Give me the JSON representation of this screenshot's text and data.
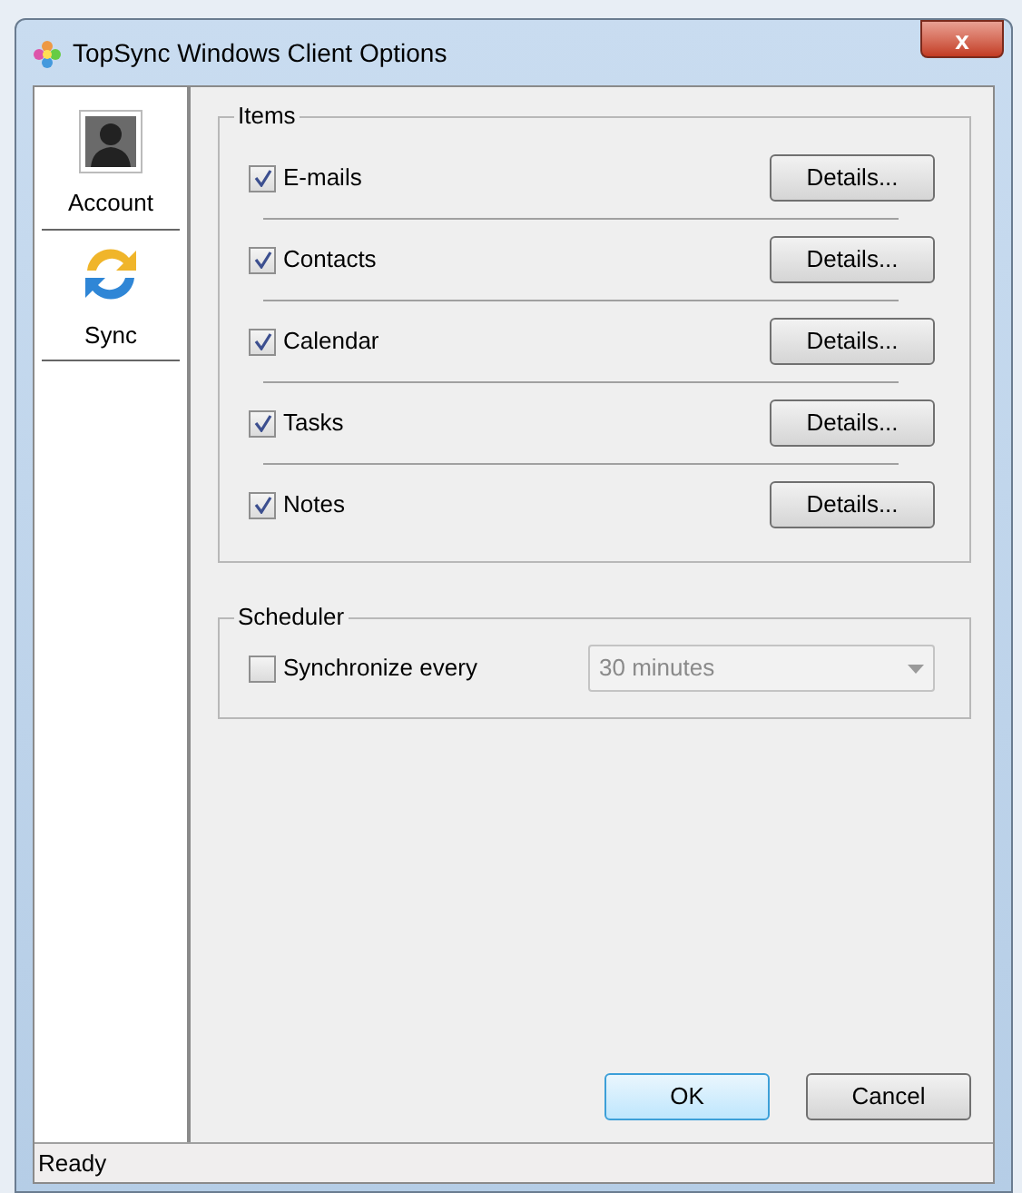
{
  "window": {
    "title": "TopSync Windows Client Options",
    "close": "x"
  },
  "sidebar": {
    "items": [
      {
        "label": "Account",
        "kind": "account",
        "selected": false
      },
      {
        "label": "Sync",
        "kind": "sync",
        "selected": false
      }
    ]
  },
  "items_group": {
    "title": "Items",
    "rows": [
      {
        "label": "E-mails",
        "checked": true,
        "button": "Details..."
      },
      {
        "label": "Contacts",
        "checked": true,
        "button": "Details..."
      },
      {
        "label": "Calendar",
        "checked": true,
        "button": "Details..."
      },
      {
        "label": "Tasks",
        "checked": true,
        "button": "Details..."
      },
      {
        "label": "Notes",
        "checked": true,
        "button": "Details..."
      }
    ]
  },
  "scheduler": {
    "title": "Scheduler",
    "checkbox": {
      "label": "Synchronize every",
      "checked": false
    },
    "interval": {
      "value": "30 minutes",
      "disabled": true
    }
  },
  "buttons": [
    {
      "label": "OK",
      "default": true
    },
    {
      "label": "Cancel",
      "default": false
    }
  ],
  "status_bar": "Ready"
}
